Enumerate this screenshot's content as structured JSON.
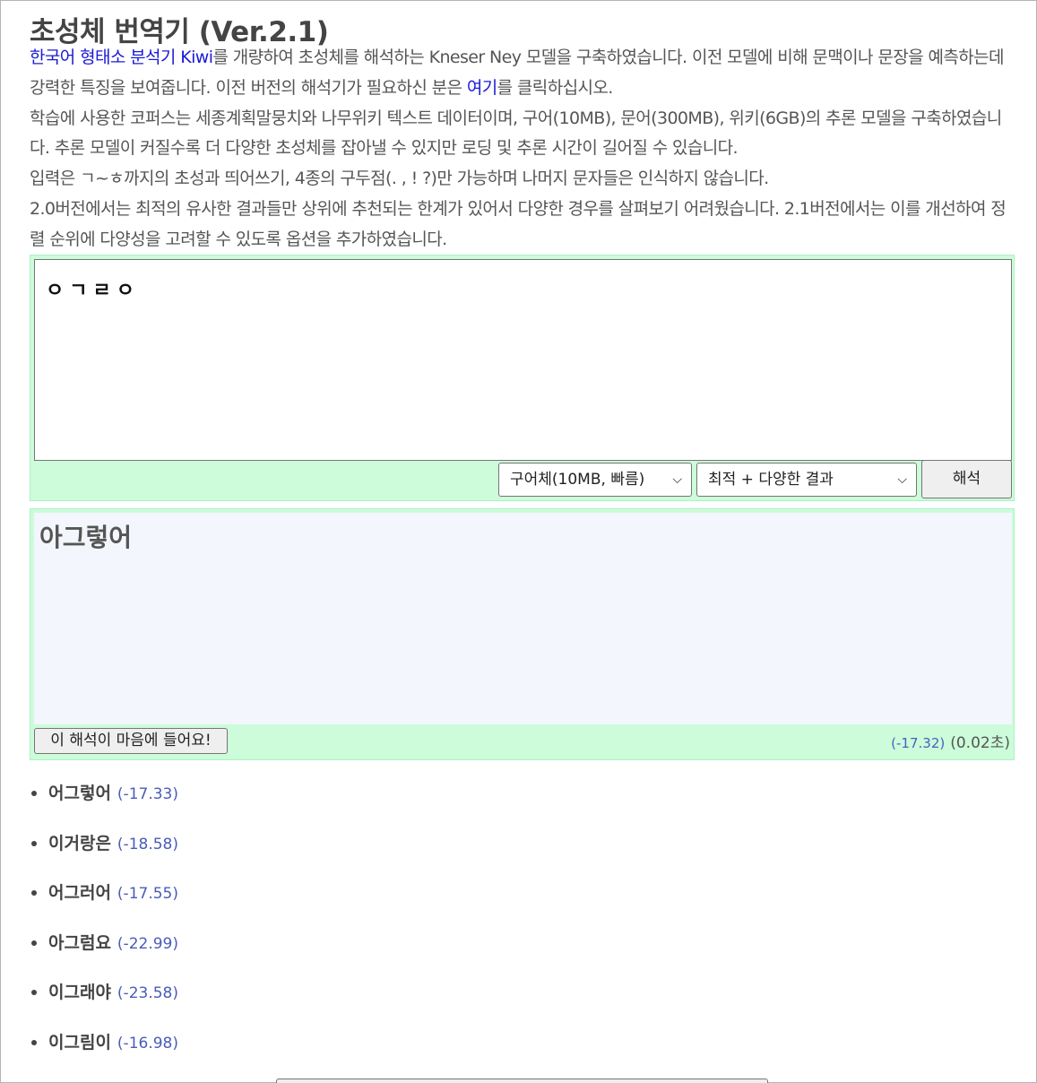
{
  "page": {
    "title": "초성체 번역기 (Ver.2.1)"
  },
  "intro": {
    "p1_link": "한국어 형태소 분석기 Kiwi",
    "p1_text": "를 개량하여 초성체를 해석하는 Kneser Ney 모델을 구축하였습니다. 이전 모델에 비해 문맥이나 문장을 예측하는데 강력한 특징을 보여줍니다. 이전 버전의 해석기가 필요하신 분은 ",
    "p1_link2": "여기",
    "p1_text2": "를 클릭하십시오.",
    "p2": "학습에 사용한 코퍼스는 세종계획말뭉치와 나무위키 텍스트 데이터이며, 구어(10MB), 문어(300MB), 위키(6GB)의 추론 모델을 구축하였습니다. 추론 모델이 커질수록 더 다양한 초성체를 잡아낼 수 있지만 로딩 및 추론 시간이 길어질 수 있습니다.",
    "p3": "입력은 ㄱ~ㅎ까지의 초성과 띄어쓰기, 4종의 구두점(. , ! ?)만 가능하며 나머지 문자들은 인식하지 않습니다.",
    "p4": "2.0버전에서는 최적의 유사한 결과들만 상위에 추천되는 한계가 있어서 다양한 경우를 살펴보기 어려웠습니다. 2.1버전에서는 이를 개선하여 정렬 순위에 다양성을 고려할 수 있도록 옵션을 추가하였습니다."
  },
  "input": {
    "value": "ㅇㄱㄹㅇ",
    "model_select": "구어체(10MB, 빠름)",
    "option_select": "최적 + 다양한 결과",
    "run_label": "해석"
  },
  "output": {
    "result": "아그렇어",
    "like_label": "이 해석이 마음에 들어요!",
    "score": "(-17.32)",
    "time": "(0.02초)"
  },
  "candidates": [
    {
      "text": "어그렇어",
      "score": "(-17.33)"
    },
    {
      "text": "이거랑은",
      "score": "(-18.58)"
    },
    {
      "text": "어그러어",
      "score": "(-17.55)"
    },
    {
      "text": "아그럼요",
      "score": "(-22.99)"
    },
    {
      "text": "이그래야",
      "score": "(-23.58)"
    },
    {
      "text": "이그림이",
      "score": "(-16.98)"
    }
  ],
  "colors": {
    "panel_bg": "#ccfcd9",
    "output_bg": "#f3f6fd",
    "link": "#1a1ad8",
    "score": "#4a5cb8"
  }
}
